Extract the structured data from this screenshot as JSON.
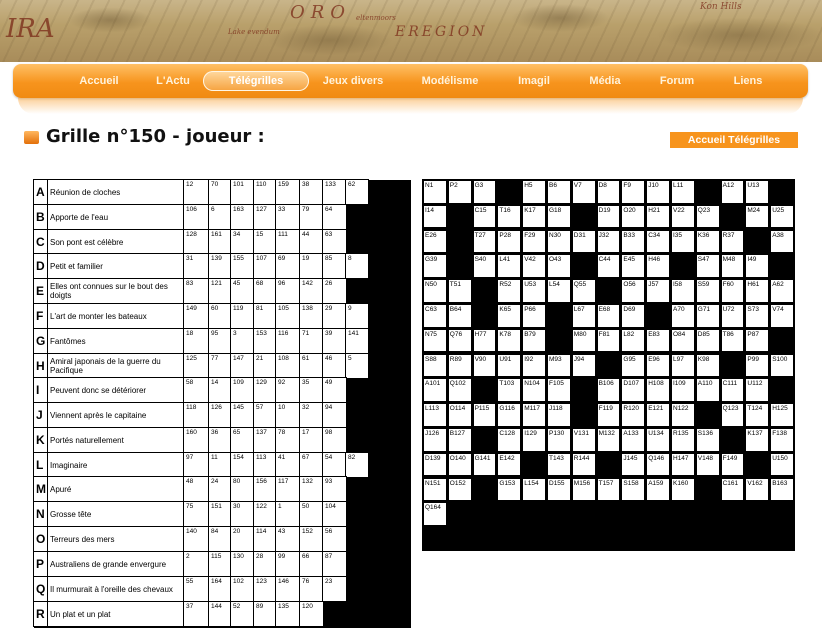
{
  "banner": {
    "labels": [
      "IRA",
      "ORO",
      "EREGION",
      "Lake evendum",
      "eltenmoors",
      "Kon Hills"
    ]
  },
  "nav": {
    "items": [
      "Accueil",
      "L'Actu",
      "Télégrilles",
      "Jeux divers",
      "Modélisme",
      "Imagil",
      "Média",
      "Forum",
      "Liens"
    ],
    "active": 2
  },
  "page": {
    "title": "Grille n°150 - joueur :",
    "home_button": "Accueil Télégrilles"
  },
  "definitions": [
    {
      "letter": "A",
      "text": "Réunion de cloches",
      "nums": [
        "12",
        "70",
        "101",
        "110",
        "159",
        "38",
        "133",
        "62"
      ]
    },
    {
      "letter": "B",
      "text": "Apporte de l'eau",
      "nums": [
        "106",
        "6",
        "163",
        "127",
        "33",
        "79",
        "64"
      ]
    },
    {
      "letter": "C",
      "text": "Son pont est célèbre",
      "nums": [
        "128",
        "161",
        "34",
        "15",
        "111",
        "44",
        "63"
      ]
    },
    {
      "letter": "D",
      "text": "Petit et familier",
      "nums": [
        "31",
        "139",
        "155",
        "107",
        "69",
        "19",
        "85",
        "8"
      ]
    },
    {
      "letter": "E",
      "text": "Elles ont connues sur le bout des doigts",
      "nums": [
        "83",
        "121",
        "45",
        "68",
        "96",
        "142",
        "26"
      ]
    },
    {
      "letter": "F",
      "text": "L'art de monter les bateaux",
      "nums": [
        "149",
        "60",
        "119",
        "81",
        "105",
        "138",
        "29",
        "9"
      ]
    },
    {
      "letter": "G",
      "text": "Fantômes",
      "nums": [
        "18",
        "95",
        "3",
        "153",
        "116",
        "71",
        "39",
        "141"
      ]
    },
    {
      "letter": "H",
      "text": "Amiral japonais de la guerre du Pacifique",
      "nums": [
        "125",
        "77",
        "147",
        "21",
        "108",
        "61",
        "46",
        "5"
      ]
    },
    {
      "letter": "I",
      "text": "Peuvent donc se détériorer",
      "nums": [
        "58",
        "14",
        "109",
        "129",
        "92",
        "35",
        "49"
      ]
    },
    {
      "letter": "J",
      "text": "Viennent après le capitaine",
      "nums": [
        "118",
        "126",
        "145",
        "57",
        "10",
        "32",
        "94"
      ]
    },
    {
      "letter": "K",
      "text": "Portés naturellement",
      "nums": [
        "160",
        "36",
        "65",
        "137",
        "78",
        "17",
        "98"
      ]
    },
    {
      "letter": "L",
      "text": "Imaginaire",
      "nums": [
        "97",
        "11",
        "154",
        "113",
        "41",
        "67",
        "54",
        "82"
      ]
    },
    {
      "letter": "M",
      "text": "Apuré",
      "nums": [
        "48",
        "24",
        "80",
        "156",
        "117",
        "132",
        "93"
      ]
    },
    {
      "letter": "N",
      "text": "Grosse tête",
      "nums": [
        "75",
        "151",
        "30",
        "122",
        "1",
        "50",
        "104"
      ]
    },
    {
      "letter": "O",
      "text": "Terreurs des mers",
      "nums": [
        "140",
        "84",
        "20",
        "114",
        "43",
        "152",
        "56"
      ]
    },
    {
      "letter": "P",
      "text": "Australiens de grande envergure",
      "nums": [
        "2",
        "115",
        "130",
        "28",
        "99",
        "66",
        "87"
      ]
    },
    {
      "letter": "Q",
      "text": "Il murmurait à l'oreille des chevaux",
      "nums": [
        "55",
        "164",
        "102",
        "123",
        "146",
        "76",
        "23"
      ]
    },
    {
      "letter": "R",
      "text": "Un plat et un plat",
      "nums": [
        "37",
        "144",
        "52",
        "89",
        "135",
        "120"
      ]
    }
  ],
  "grid": [
    [
      "N1",
      "P2",
      "G3",
      "#",
      "H5",
      "B6",
      "V7",
      "D8",
      "F9",
      "J10",
      "L11",
      "#",
      "A12",
      "U13"
    ],
    [
      "I14",
      "#",
      "C15",
      "T16",
      "K17",
      "G18",
      "#",
      "D19",
      "O20",
      "H21",
      "V22",
      "Q23",
      "#",
      "M24",
      "U25"
    ],
    [
      "E26",
      "#",
      "T27",
      "P28",
      "F29",
      "N30",
      "D31",
      "J32",
      "B33",
      "C34",
      "I35",
      "K36",
      "R37",
      "#",
      "A38"
    ],
    [
      "G39",
      "#",
      "S40",
      "L41",
      "V42",
      "O43",
      "#",
      "C44",
      "E45",
      "H46",
      "#",
      "S47",
      "M48",
      "I49",
      "#"
    ],
    [
      "N50",
      "T51",
      "#",
      "R52",
      "U53",
      "L54",
      "Q55",
      "#",
      "O56",
      "J57",
      "I58",
      "S59",
      "F60",
      "H61",
      "A62"
    ],
    [
      "C63",
      "B64",
      "#",
      "K65",
      "P66",
      "#",
      "L67",
      "E68",
      "D69",
      "#",
      "A70",
      "G71",
      "U72",
      "S73",
      "V74"
    ],
    [
      "N75",
      "Q76",
      "H77",
      "K78",
      "B79",
      "#",
      "M80",
      "F81",
      "L82",
      "E83",
      "O84",
      "D85",
      "T86",
      "P87",
      "#"
    ],
    [
      "S88",
      "R89",
      "V90",
      "U91",
      "I92",
      "M93",
      "J94",
      "#",
      "G95",
      "E96",
      "L97",
      "K98",
      "#",
      "P99",
      "S100"
    ],
    [
      "A101",
      "Q102",
      "#",
      "T103",
      "N104",
      "F105",
      "#",
      "B106",
      "D107",
      "H108",
      "I109",
      "A110",
      "C111",
      "U112",
      "#"
    ],
    [
      "L113",
      "O114",
      "P115",
      "G116",
      "M117",
      "J118",
      "#",
      "F119",
      "R120",
      "E121",
      "N122",
      "#",
      "Q123",
      "T124",
      "H125"
    ],
    [
      "J126",
      "B127",
      "#",
      "C128",
      "I129",
      "P130",
      "V131",
      "M132",
      "A133",
      "U134",
      "R135",
      "S136",
      "#",
      "K137",
      "F138"
    ],
    [
      "D139",
      "O140",
      "G141",
      "E142",
      "#",
      "T143",
      "R144",
      "#",
      "J145",
      "Q146",
      "H147",
      "V148",
      "F149",
      "#",
      "U150"
    ],
    [
      "N151",
      "O152",
      "#",
      "G153",
      "L154",
      "D155",
      "M156",
      "T157",
      "S158",
      "A159",
      "K160",
      "#",
      "C161",
      "V162",
      "B163"
    ],
    [
      "Q164",
      "#",
      "#",
      "#",
      "#",
      "#",
      "#",
      "#",
      "#",
      "#",
      "#",
      "#",
      "#",
      "#",
      "#"
    ]
  ]
}
